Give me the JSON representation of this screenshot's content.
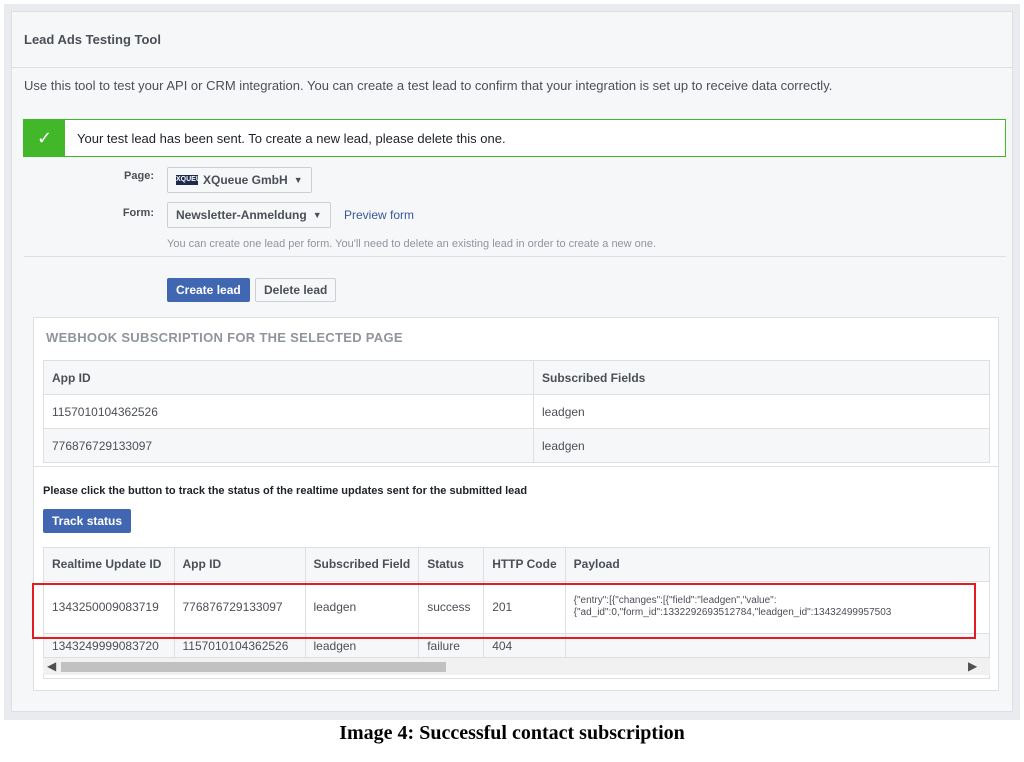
{
  "header": {
    "title": "Lead Ads Testing Tool"
  },
  "intro": "Use this tool to test your API or CRM integration. You can create a test lead to confirm that your integration is set up to receive data correctly.",
  "banner": {
    "text": "Your test lead has been sent. To create a new lead, please delete this one.",
    "icon": "check-icon"
  },
  "form": {
    "page_label": "Page:",
    "page_value": "XQueue GmbH",
    "page_logo_text": "XQUEUE",
    "form_label": "Form:",
    "form_value": "Newsletter-Anmeldung",
    "preview_link": "Preview form",
    "hint": "You can create one lead per form. You'll need to delete an existing lead in order to create a new one."
  },
  "actions": {
    "create_label": "Create lead",
    "delete_label": "Delete lead"
  },
  "webhook": {
    "title": "WEBHOOK SUBSCRIPTION FOR THE SELECTED PAGE",
    "columns": [
      "App ID",
      "Subscribed Fields"
    ],
    "rows": [
      [
        "1157010104362526",
        "leadgen"
      ],
      [
        "776876729133097",
        "leadgen"
      ]
    ]
  },
  "tracking": {
    "text": "Please click the button to track the status of the realtime updates sent for the submitted lead",
    "button_label": "Track status",
    "columns": [
      "Realtime Update ID",
      "App ID",
      "Subscribed Field",
      "Status",
      "HTTP Code",
      "Payload"
    ],
    "rows": [
      {
        "id": "1343250009083719",
        "app_id": "776876729133097",
        "field": "leadgen",
        "status": "success",
        "code": "201",
        "payload_line1": "{\"entry\":[{\"changes\":[{\"field\":\"leadgen\",\"value\":",
        "payload_line2": "{\"ad_id\":0,\"form_id\":1332292693512784,\"leadgen_id\":13432499957503"
      },
      {
        "id": "1343249999083720",
        "app_id": "1157010104362526",
        "field": "leadgen",
        "status": "failure",
        "code": "404",
        "payload_line1": "",
        "payload_line2": ""
      }
    ]
  },
  "caption": "Image 4: Successful contact subscription",
  "colors": {
    "primary": "#4267b2",
    "success": "#42b72a",
    "highlight": "#e31b23"
  }
}
